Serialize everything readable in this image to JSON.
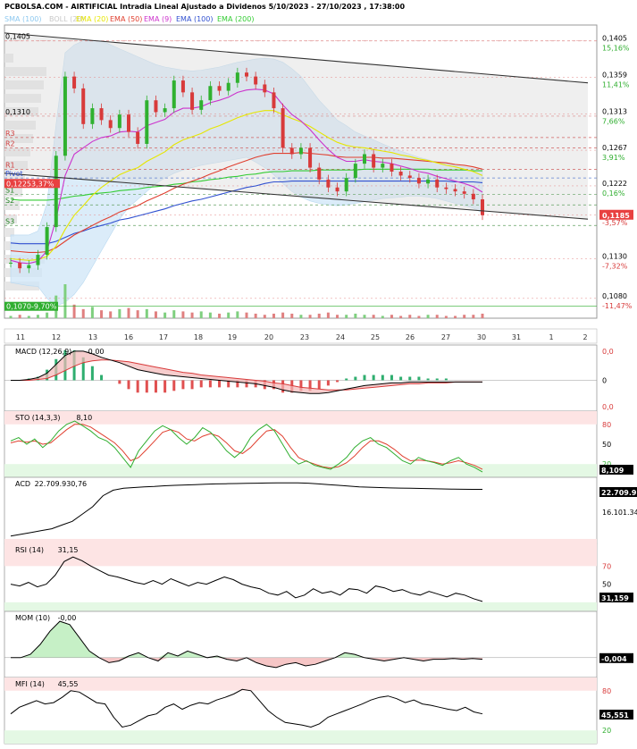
{
  "header": {
    "title": "PCBOLSA.COM - AIRTIFICIAL Intradia Lineal Ajustado a Dividenos 5/10/2023 - 27/10/2023 , 17:38:00",
    "legend": [
      {
        "label": "SMA (100)",
        "color": "#8ec9f0"
      },
      {
        "label": "BOLL (20)",
        "color": "#c8c8c8"
      },
      {
        "label": "EMA (20)",
        "color": "#e6e600"
      },
      {
        "label": "EMA (50)",
        "color": "#e04030"
      },
      {
        "label": "EMA (9)",
        "color": "#cc33cc"
      },
      {
        "label": "EMA (100)",
        "color": "#3050d0"
      },
      {
        "label": "EMA (200)",
        "color": "#33cc33"
      }
    ]
  },
  "chart_data": [
    {
      "type": "candlestick",
      "name": "price",
      "x_labels": [
        "11",
        "12",
        "13",
        "16",
        "17",
        "18",
        "19",
        "20",
        "23",
        "24",
        "25",
        "26",
        "27",
        "30",
        "31",
        "1",
        "2"
      ],
      "ylim": [
        0.1055,
        0.1425
      ],
      "price_ticks": [
        "0,1405",
        "0,1359",
        "0,1313",
        "0,1267",
        "0,1222",
        "0,1185",
        "0,1130",
        "0,1080"
      ],
      "price_tick_values": [
        0.1405,
        0.1359,
        0.1313,
        0.1267,
        0.1222,
        0.1185,
        0.113,
        0.108
      ],
      "pct_labels": [
        "15,16%",
        "11,41%",
        "7,66%",
        "3,91%",
        "0,16%",
        "-3,57%",
        "-7,32%",
        "-11,47%"
      ],
      "last_price": "0,1185",
      "level_labels": [
        {
          "text": "0,1405",
          "value": 0.1405,
          "color": "#000000"
        },
        {
          "text": "0,1310",
          "value": 0.131,
          "color": "#000000"
        },
        {
          "text": "R3",
          "value": 0.1283,
          "color": "#d04040"
        },
        {
          "text": "R2",
          "value": 0.127,
          "color": "#d04040"
        },
        {
          "text": "R1",
          "value": 0.1243,
          "color": "#d04040"
        },
        {
          "text": "Pivot",
          "value": 0.1232,
          "color": "#3050d0"
        },
        {
          "text": "S1",
          "value": 0.1211,
          "color": "#208020"
        },
        {
          "text": "S2",
          "value": 0.1198,
          "color": "#208020"
        },
        {
          "text": "S3",
          "value": 0.1172,
          "color": "#208020"
        }
      ],
      "marker_high": "0,1225",
      "marker_high_pct": "3,37%",
      "marker_low": "0,1070",
      "marker_low_pct": "-9,70%",
      "closes": [
        0.1125,
        0.1118,
        0.1122,
        0.1135,
        0.117,
        0.126,
        0.136,
        0.1345,
        0.13,
        0.132,
        0.1305,
        0.1295,
        0.1312,
        0.129,
        0.1275,
        0.133,
        0.1315,
        0.132,
        0.1355,
        0.134,
        0.1318,
        0.133,
        0.1348,
        0.1342,
        0.1352,
        0.1365,
        0.136,
        0.135,
        0.134,
        0.132,
        0.127,
        0.1262,
        0.127,
        0.1245,
        0.123,
        0.122,
        0.1215,
        0.1232,
        0.125,
        0.1262,
        0.1245,
        0.125,
        0.124,
        0.1235,
        0.1232,
        0.1225,
        0.123,
        0.122,
        0.1218,
        0.1215,
        0.1212,
        0.1205,
        0.1185
      ],
      "volumes": [
        2,
        3,
        2,
        3,
        5,
        20,
        30,
        12,
        8,
        10,
        7,
        6,
        8,
        9,
        7,
        8,
        6,
        5,
        7,
        6,
        5,
        6,
        5,
        4,
        5,
        6,
        5,
        4,
        3,
        4,
        5,
        4,
        3,
        3,
        4,
        5,
        3,
        3,
        4,
        3,
        3,
        2,
        3,
        2,
        3,
        2,
        3,
        3,
        2,
        2,
        3,
        3,
        4
      ],
      "ema9": [
        0.1128,
        0.1125,
        0.1124,
        0.1127,
        0.114,
        0.118,
        0.1235,
        0.1262,
        0.127,
        0.1278,
        0.1283,
        0.1285,
        0.129,
        0.1291,
        0.129,
        0.1298,
        0.1302,
        0.1306,
        0.1315,
        0.132,
        0.132,
        0.1322,
        0.1327,
        0.133,
        0.1334,
        0.134,
        0.1343,
        0.1344,
        0.1343,
        0.1338,
        0.1324,
        0.1312,
        0.1304,
        0.1293,
        0.128,
        0.1268,
        0.1258,
        0.1253,
        0.1253,
        0.1255,
        0.1253,
        0.1252,
        0.125,
        0.1247,
        0.1244,
        0.124,
        0.1238,
        0.1234,
        0.1231,
        0.1228,
        0.1225,
        0.1221,
        0.1214
      ],
      "ema20": [
        0.113,
        0.1129,
        0.1128,
        0.1129,
        0.1133,
        0.1146,
        0.1167,
        0.1185,
        0.1197,
        0.121,
        0.122,
        0.1228,
        0.1236,
        0.1241,
        0.1245,
        0.1253,
        0.1259,
        0.1265,
        0.1274,
        0.128,
        0.1284,
        0.1288,
        0.1294,
        0.1298,
        0.1303,
        0.1308,
        0.1312,
        0.1315,
        0.1317,
        0.1317,
        0.1312,
        0.1307,
        0.1303,
        0.1297,
        0.129,
        0.1283,
        0.1277,
        0.1273,
        0.1271,
        0.127,
        0.1268,
        0.1266,
        0.1264,
        0.1261,
        0.1259,
        0.1256,
        0.1254,
        0.1251,
        0.1248,
        0.1246,
        0.1243,
        0.124,
        0.1235
      ],
      "ema50": [
        0.114,
        0.1139,
        0.1138,
        0.1138,
        0.1139,
        0.1144,
        0.1152,
        0.116,
        0.1166,
        0.1172,
        0.1178,
        0.1183,
        0.1189,
        0.1193,
        0.1197,
        0.1203,
        0.1208,
        0.1213,
        0.1219,
        0.1224,
        0.1228,
        0.1232,
        0.1237,
        0.1241,
        0.1246,
        0.125,
        0.1254,
        0.1258,
        0.1261,
        0.1263,
        0.1263,
        0.1263,
        0.1264,
        0.1263,
        0.1262,
        0.1261,
        0.1259,
        0.1258,
        0.1258,
        0.1258,
        0.1258,
        0.1257,
        0.1257,
        0.1256,
        0.1255,
        0.1254,
        0.1253,
        0.1252,
        0.1251,
        0.1249,
        0.1248,
        0.1246,
        0.1243
      ],
      "ema100": [
        0.115,
        0.1149,
        0.1149,
        0.1149,
        0.1149,
        0.1152,
        0.1157,
        0.1162,
        0.1165,
        0.1169,
        0.1172,
        0.1175,
        0.1179,
        0.1181,
        0.1184,
        0.1187,
        0.119,
        0.1193,
        0.1197,
        0.12,
        0.1203,
        0.1205,
        0.1208,
        0.1211,
        0.1214,
        0.1217,
        0.122,
        0.1222,
        0.1225,
        0.1227,
        0.1227,
        0.1228,
        0.1228,
        0.1228,
        0.1228,
        0.1228,
        0.1228,
        0.1228,
        0.1228,
        0.1228,
        0.1228,
        0.1228,
        0.1228,
        0.1228,
        0.1228,
        0.1228,
        0.1228,
        0.1228,
        0.1228,
        0.1227,
        0.1227,
        0.1227,
        0.1226
      ],
      "ema200": [
        0.1205,
        0.1204,
        0.1204,
        0.1204,
        0.1204,
        0.1205,
        0.1207,
        0.1209,
        0.121,
        0.1212,
        0.1213,
        0.1214,
        0.1216,
        0.1217,
        0.1218,
        0.122,
        0.1221,
        0.1222,
        0.1224,
        0.1225,
        0.1227,
        0.1228,
        0.123,
        0.1231,
        0.1233,
        0.1234,
        0.1236,
        0.1237,
        0.1239,
        0.124,
        0.124,
        0.1241,
        0.1241,
        0.1241,
        0.1242,
        0.1242,
        0.1242,
        0.1242,
        0.1242,
        0.1243,
        0.1243,
        0.1243,
        0.1243,
        0.1243,
        0.1243,
        0.1243,
        0.1243,
        0.1242,
        0.1242,
        0.1242,
        0.1242,
        0.1241,
        0.1241
      ],
      "bb_upper": [
        0.116,
        0.116,
        0.116,
        0.1165,
        0.12,
        0.13,
        0.139,
        0.14,
        0.1405,
        0.1405,
        0.1405,
        0.14,
        0.1395,
        0.139,
        0.1385,
        0.138,
        0.1375,
        0.1372,
        0.137,
        0.1368,
        0.1367,
        0.1368,
        0.137,
        0.1372,
        0.1375,
        0.1378,
        0.138,
        0.1382,
        0.1383,
        0.1382,
        0.1378,
        0.137,
        0.136,
        0.1345,
        0.133,
        0.1318,
        0.1305,
        0.1298,
        0.129,
        0.1285,
        0.128,
        0.1275,
        0.127,
        0.1266,
        0.1262,
        0.1258,
        0.1255,
        0.1252,
        0.125,
        0.1248,
        0.1246,
        0.1244,
        0.1242
      ],
      "bb_lower": [
        0.11,
        0.1098,
        0.1096,
        0.1095,
        0.108,
        0.107,
        0.1075,
        0.1085,
        0.11,
        0.112,
        0.114,
        0.116,
        0.118,
        0.1195,
        0.1205,
        0.1215,
        0.1225,
        0.1232,
        0.1238,
        0.1242,
        0.1245,
        0.1248,
        0.125,
        0.1252,
        0.1254,
        0.1256,
        0.1258,
        0.1252,
        0.1245,
        0.1236,
        0.1225,
        0.1215,
        0.1208,
        0.1203,
        0.12,
        0.1198,
        0.1197,
        0.1198,
        0.12,
        0.1202,
        0.1204,
        0.1206,
        0.1207,
        0.1208,
        0.1209,
        0.1209,
        0.1208,
        0.1206,
        0.1203,
        0.12,
        0.1197,
        0.1194,
        0.1188
      ]
    },
    {
      "type": "line",
      "name": "MACD",
      "label": "MACD (12,26,9)",
      "value": "-0,00",
      "right_labels": [
        "0,0",
        "0",
        "0,0"
      ],
      "macd": [
        0.0,
        0.0,
        0.1,
        0.3,
        0.8,
        1.8,
        2.8,
        3.3,
        3.3,
        3.0,
        2.6,
        2.3,
        2.0,
        1.6,
        1.2,
        1.0,
        0.8,
        0.6,
        0.5,
        0.4,
        0.3,
        0.2,
        0.1,
        0.0,
        -0.1,
        -0.2,
        -0.3,
        -0.4,
        -0.6,
        -0.8,
        -1.1,
        -1.3,
        -1.4,
        -1.5,
        -1.5,
        -1.4,
        -1.2,
        -1.0,
        -0.8,
        -0.6,
        -0.5,
        -0.4,
        -0.3,
        -0.3,
        -0.2,
        -0.2,
        -0.2,
        -0.2,
        -0.2,
        -0.2,
        -0.2,
        -0.2,
        -0.2
      ],
      "signal": [
        0.0,
        0.0,
        0.0,
        0.1,
        0.2,
        0.6,
        1.1,
        1.6,
        2.0,
        2.2,
        2.3,
        2.3,
        2.2,
        2.1,
        1.9,
        1.7,
        1.5,
        1.3,
        1.1,
        0.9,
        0.8,
        0.6,
        0.5,
        0.4,
        0.3,
        0.2,
        0.1,
        0.0,
        -0.1,
        -0.3,
        -0.4,
        -0.6,
        -0.8,
        -0.9,
        -1.0,
        -1.1,
        -1.1,
        -1.1,
        -1.0,
        -0.9,
        -0.8,
        -0.7,
        -0.6,
        -0.5,
        -0.4,
        -0.4,
        -0.3,
        -0.3,
        -0.3,
        -0.2,
        -0.2,
        -0.2,
        -0.2
      ]
    },
    {
      "type": "line",
      "name": "STO",
      "label": "STO (14,3,3)",
      "value": "8,10",
      "last": "8,109",
      "levels": [
        "80",
        "50",
        "20"
      ],
      "k": [
        55,
        60,
        50,
        58,
        45,
        55,
        70,
        80,
        85,
        78,
        70,
        60,
        55,
        45,
        30,
        15,
        40,
        55,
        70,
        78,
        72,
        60,
        50,
        60,
        75,
        68,
        55,
        40,
        30,
        40,
        60,
        72,
        80,
        70,
        50,
        30,
        20,
        25,
        18,
        15,
        12,
        20,
        30,
        45,
        55,
        60,
        50,
        45,
        35,
        25,
        20,
        30,
        25,
        22,
        18,
        25,
        30,
        20,
        15,
        8
      ],
      "d": [
        52,
        55,
        53,
        55,
        50,
        52,
        62,
        72,
        80,
        80,
        76,
        68,
        60,
        52,
        40,
        25,
        30,
        42,
        55,
        68,
        72,
        68,
        58,
        55,
        62,
        66,
        62,
        52,
        40,
        36,
        45,
        58,
        70,
        72,
        62,
        45,
        30,
        24,
        20,
        16,
        14,
        16,
        22,
        32,
        45,
        55,
        55,
        50,
        42,
        32,
        25,
        26,
        25,
        23,
        20,
        22,
        25,
        22,
        18,
        12
      ]
    },
    {
      "type": "line",
      "name": "ACD",
      "label": "ACD",
      "value": "22.709.930,76",
      "right_labels": [
        "22.709.9",
        "16.101.34"
      ],
      "values": [
        10,
        10.5,
        11,
        11.5,
        12,
        13,
        14,
        16,
        18,
        21,
        22.5,
        23,
        23.2,
        23.4,
        23.5,
        23.7,
        23.8,
        23.9,
        24.0,
        24.1,
        24.2,
        24.25,
        24.3,
        24.35,
        24.4,
        24.45,
        24.5,
        24.5,
        24.5,
        24.4,
        24.2,
        24.0,
        23.8,
        23.6,
        23.4,
        23.3,
        23.2,
        23.1,
        23.05,
        23.0,
        22.95,
        22.9,
        22.85,
        22.8,
        22.75,
        22.72,
        22.71
      ]
    },
    {
      "type": "line",
      "name": "RSI",
      "label": "RSI (14)",
      "value": "31,15",
      "last": "31,159",
      "levels": [
        "70",
        "50"
      ],
      "values": [
        50,
        48,
        52,
        47,
        50,
        60,
        75,
        80,
        76,
        70,
        65,
        60,
        58,
        55,
        52,
        50,
        54,
        50,
        56,
        52,
        48,
        52,
        50,
        54,
        58,
        55,
        50,
        47,
        45,
        40,
        38,
        42,
        35,
        38,
        45,
        40,
        42,
        38,
        45,
        44,
        40,
        48,
        46,
        42,
        44,
        40,
        38,
        42,
        39,
        36,
        40,
        38,
        34,
        31
      ]
    },
    {
      "type": "line",
      "name": "MOM",
      "label": "MOM (10)",
      "value": "-0,00",
      "last": "-0,004",
      "values": [
        0.0,
        0.0,
        0.2,
        0.8,
        1.6,
        2.2,
        2.0,
        1.2,
        0.4,
        0.0,
        -0.3,
        -0.2,
        0.1,
        0.3,
        0.0,
        -0.2,
        0.3,
        0.1,
        0.4,
        0.2,
        0.0,
        0.1,
        -0.1,
        -0.2,
        0.0,
        -0.3,
        -0.5,
        -0.6,
        -0.4,
        -0.3,
        -0.5,
        -0.4,
        -0.2,
        0.0,
        0.3,
        0.2,
        0.0,
        -0.1,
        -0.2,
        -0.1,
        0.0,
        -0.1,
        -0.2,
        -0.1,
        -0.1,
        -0.05,
        -0.1,
        -0.05,
        -0.1
      ]
    },
    {
      "type": "line",
      "name": "MFI",
      "label": "MFI (14)",
      "value": "45,55",
      "last": "45,551",
      "levels": [
        "80",
        "20"
      ],
      "values": [
        45,
        55,
        60,
        65,
        60,
        62,
        70,
        80,
        78,
        70,
        62,
        60,
        40,
        25,
        28,
        35,
        42,
        45,
        55,
        60,
        52,
        58,
        62,
        60,
        66,
        70,
        75,
        82,
        80,
        65,
        50,
        40,
        32,
        30,
        28,
        25,
        30,
        40,
        45,
        50,
        55,
        60,
        66,
        70,
        72,
        68,
        62,
        66,
        60,
        58,
        55,
        52,
        50,
        55,
        48,
        45
      ]
    }
  ]
}
